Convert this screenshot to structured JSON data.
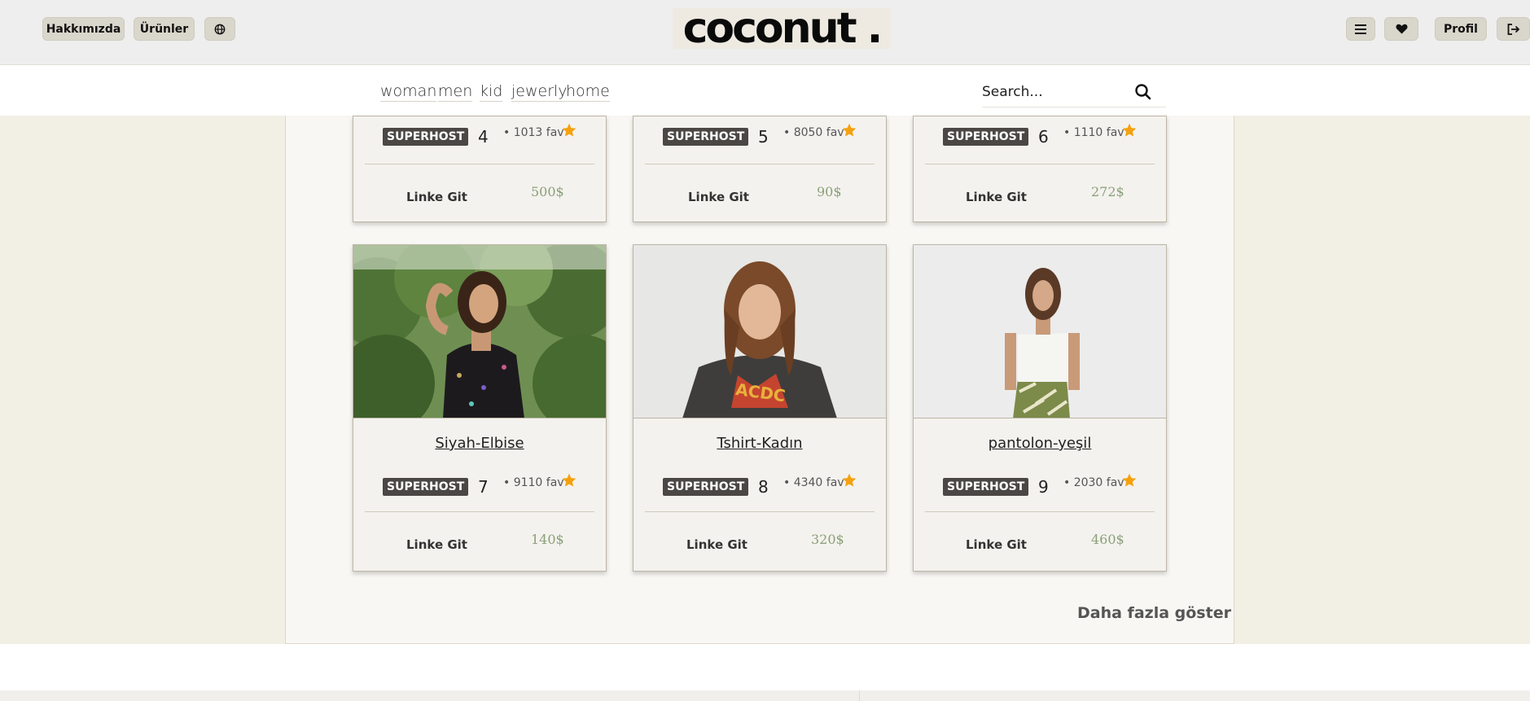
{
  "header": {
    "about_label": "Hakkımızda",
    "products_label": "Ürünler",
    "logo_text": "coconut .",
    "profile_label": "Profil"
  },
  "nav": {
    "links": [
      "woman",
      "men",
      "kid",
      "jewerly",
      "home"
    ],
    "search_placeholder": "Search..."
  },
  "products": [
    {
      "title": "",
      "badge": "SUPERHOST",
      "rank": "4",
      "fav": "• 1013 fav",
      "link": "Linke Git",
      "price": "500$"
    },
    {
      "title": "",
      "badge": "SUPERHOST",
      "rank": "5",
      "fav": "• 8050 fav",
      "link": "Linke Git",
      "price": "90$"
    },
    {
      "title": "",
      "badge": "SUPERHOST",
      "rank": "6",
      "fav": "• 1110 fav",
      "link": "Linke Git",
      "price": "272$"
    },
    {
      "title": "Siyah-Elbise",
      "badge": "SUPERHOST",
      "rank": "7",
      "fav": "• 9110 fav",
      "link": "Linke Git",
      "price": "140$"
    },
    {
      "title": "Tshirt-Kadın",
      "badge": "SUPERHOST",
      "rank": "8",
      "fav": "• 4340 fav",
      "link": "Linke Git",
      "price": "320$"
    },
    {
      "title": "pantolon-yeşil",
      "badge": "SUPERHOST",
      "rank": "9",
      "fav": "• 2030 fav",
      "link": "Linke Git",
      "price": "460$"
    }
  ],
  "show_more_label": "Daha fazla göster",
  "colors": {
    "accent_star": "#f5a10f",
    "price": "#8aa07a",
    "badge_bg": "#4a4745"
  }
}
